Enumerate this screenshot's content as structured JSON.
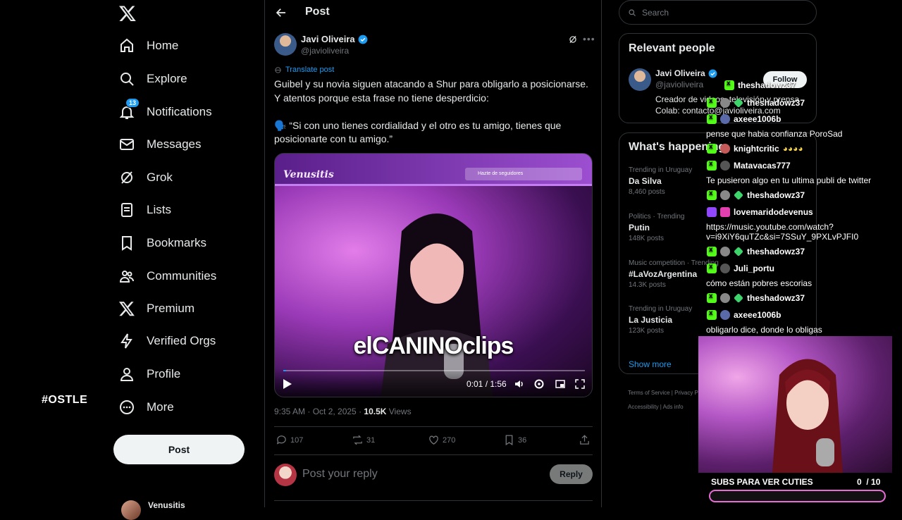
{
  "overlay_tag": "#OSTLE",
  "nav": {
    "items": [
      {
        "label": "Home",
        "icon": "home-icon"
      },
      {
        "label": "Explore",
        "icon": "search-icon"
      },
      {
        "label": "Notifications",
        "icon": "bell-icon",
        "badge": "13"
      },
      {
        "label": "Messages",
        "icon": "mail-icon"
      },
      {
        "label": "Grok",
        "icon": "grok-icon"
      },
      {
        "label": "Lists",
        "icon": "list-icon"
      },
      {
        "label": "Bookmarks",
        "icon": "bookmark-icon"
      },
      {
        "label": "Communities",
        "icon": "communities-icon"
      },
      {
        "label": "Premium",
        "icon": "x-icon"
      },
      {
        "label": "Verified Orgs",
        "icon": "lightning-icon"
      },
      {
        "label": "Profile",
        "icon": "person-icon"
      },
      {
        "label": "More",
        "icon": "more-icon"
      }
    ],
    "post_button": "Post",
    "account_name": "Venusitis"
  },
  "main": {
    "header_title": "Post",
    "author": {
      "name": "Javi Oliveira",
      "handle": "@javioliveira"
    },
    "translate": "Translate post",
    "text": "Guibel y su novia siguen atacando a Shur para obligarlo a posicionarse. Y atentos porque esta frase no tiene desperdicio:\n\n🗣️ “Si con uno tienes cordialidad y el otro es tu amigo, tienes que posicionarte con tu amigo.”",
    "video": {
      "brand": "Venusitis",
      "top_button": "Hazte de seguidores",
      "watermark": "elCANINOclips",
      "time": "0:01 / 1:56",
      "progress": 0.01
    },
    "meta": {
      "timestamp": "9:35 AM · Oct 2, 2025 · ",
      "views": "10.5K",
      "views_label": " Views"
    },
    "stats": {
      "replies": "107",
      "reposts": "31",
      "likes": "270",
      "bookmarks": "36"
    },
    "reply_placeholder": "Post your reply",
    "reply_button": "Reply"
  },
  "right": {
    "search_placeholder": "Search",
    "relevant": {
      "title": "Relevant people",
      "name": "Javi Oliveira",
      "handle": "@javioliveira",
      "bio": "Creador de videos, televisión y prensa\nColab: contacto@javioliveira.com",
      "follow": "Follow"
    },
    "happening": {
      "title": "What's happening",
      "trends": [
        {
          "meta": "Trending in Uruguay",
          "name": "Da Silva",
          "count": "8,460 posts"
        },
        {
          "meta": "Politics · Trending",
          "name": "Putin",
          "count": "148K posts"
        },
        {
          "meta": "Music competition · Trending",
          "name": "#LaVozArgentina",
          "count": "14.3K posts"
        },
        {
          "meta": "Trending in Uruguay",
          "name": "La Justicia",
          "count": "123K posts"
        }
      ],
      "show_more": "Show more"
    },
    "footer": [
      "Terms of Service",
      "Privacy Policy",
      "Accessibility",
      "Ads info"
    ]
  },
  "chat": {
    "messages": [
      {
        "user": "theshadowz37",
        "text": ""
      },
      {
        "user": "theshadowz37",
        "text": ""
      },
      {
        "user": "axeee1006b",
        "text": "pense que habia confianza PoroSad"
      },
      {
        "user": "knightcritic",
        "text": ""
      },
      {
        "user": "Matavacas777",
        "text": "Te pusieron algo en tu ultima publi de twitter"
      },
      {
        "user": "theshadowz37",
        "text": ""
      },
      {
        "user": "lovemaridodevenus",
        "text": "https://music.youtube.com/watch?\nv=i9XiY6quTZc&si=7SSuY_9PXLvPJFI0"
      },
      {
        "user": "theshadowz37",
        "text": ""
      },
      {
        "user": "Juli_portu",
        "text": "cómo están pobres escorias"
      },
      {
        "user": "theshadowz37",
        "text": ""
      },
      {
        "user": "axeee1006b",
        "text": "obligarlo dice, donde lo obligas"
      }
    ]
  },
  "subs": {
    "label": "SUBS PARA VER CUTIES",
    "current": "0",
    "goal": "10",
    "separator": "/",
    "progress": 0
  }
}
